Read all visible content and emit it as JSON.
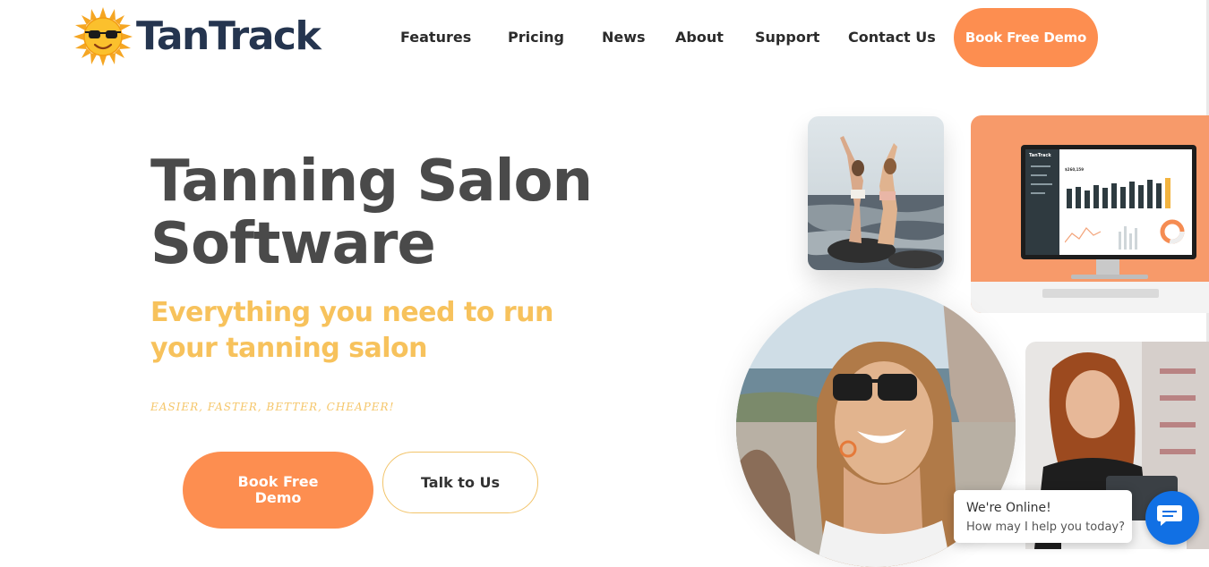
{
  "brand": {
    "name": "TanTrack"
  },
  "nav": {
    "features": "Features",
    "pricing": "Pricing",
    "news": "News",
    "about": "About",
    "support": "Support",
    "contact": "Contact Us",
    "demo": "Book Free Demo"
  },
  "hero": {
    "title": "Tanning Salon Software",
    "subtitle": "Everything you need to run your tanning salon",
    "tagline": "EASIER, FASTER, BETTER, CHEAPER!",
    "primary_cta": "Book Free Demo",
    "secondary_cta": "Talk to Us"
  },
  "mockup": {
    "app_name": "TanTrack",
    "amount": "$260,159"
  },
  "chat": {
    "status": "We're Online!",
    "prompt": "How may I help you today?"
  },
  "colors": {
    "accent": "#fd8e50",
    "yellow": "#f7c25c",
    "navy": "#25354f",
    "chat_blue": "#1170e4"
  },
  "icons": [
    "sun-sunglasses-logo-icon",
    "chat-bubble-icon"
  ]
}
